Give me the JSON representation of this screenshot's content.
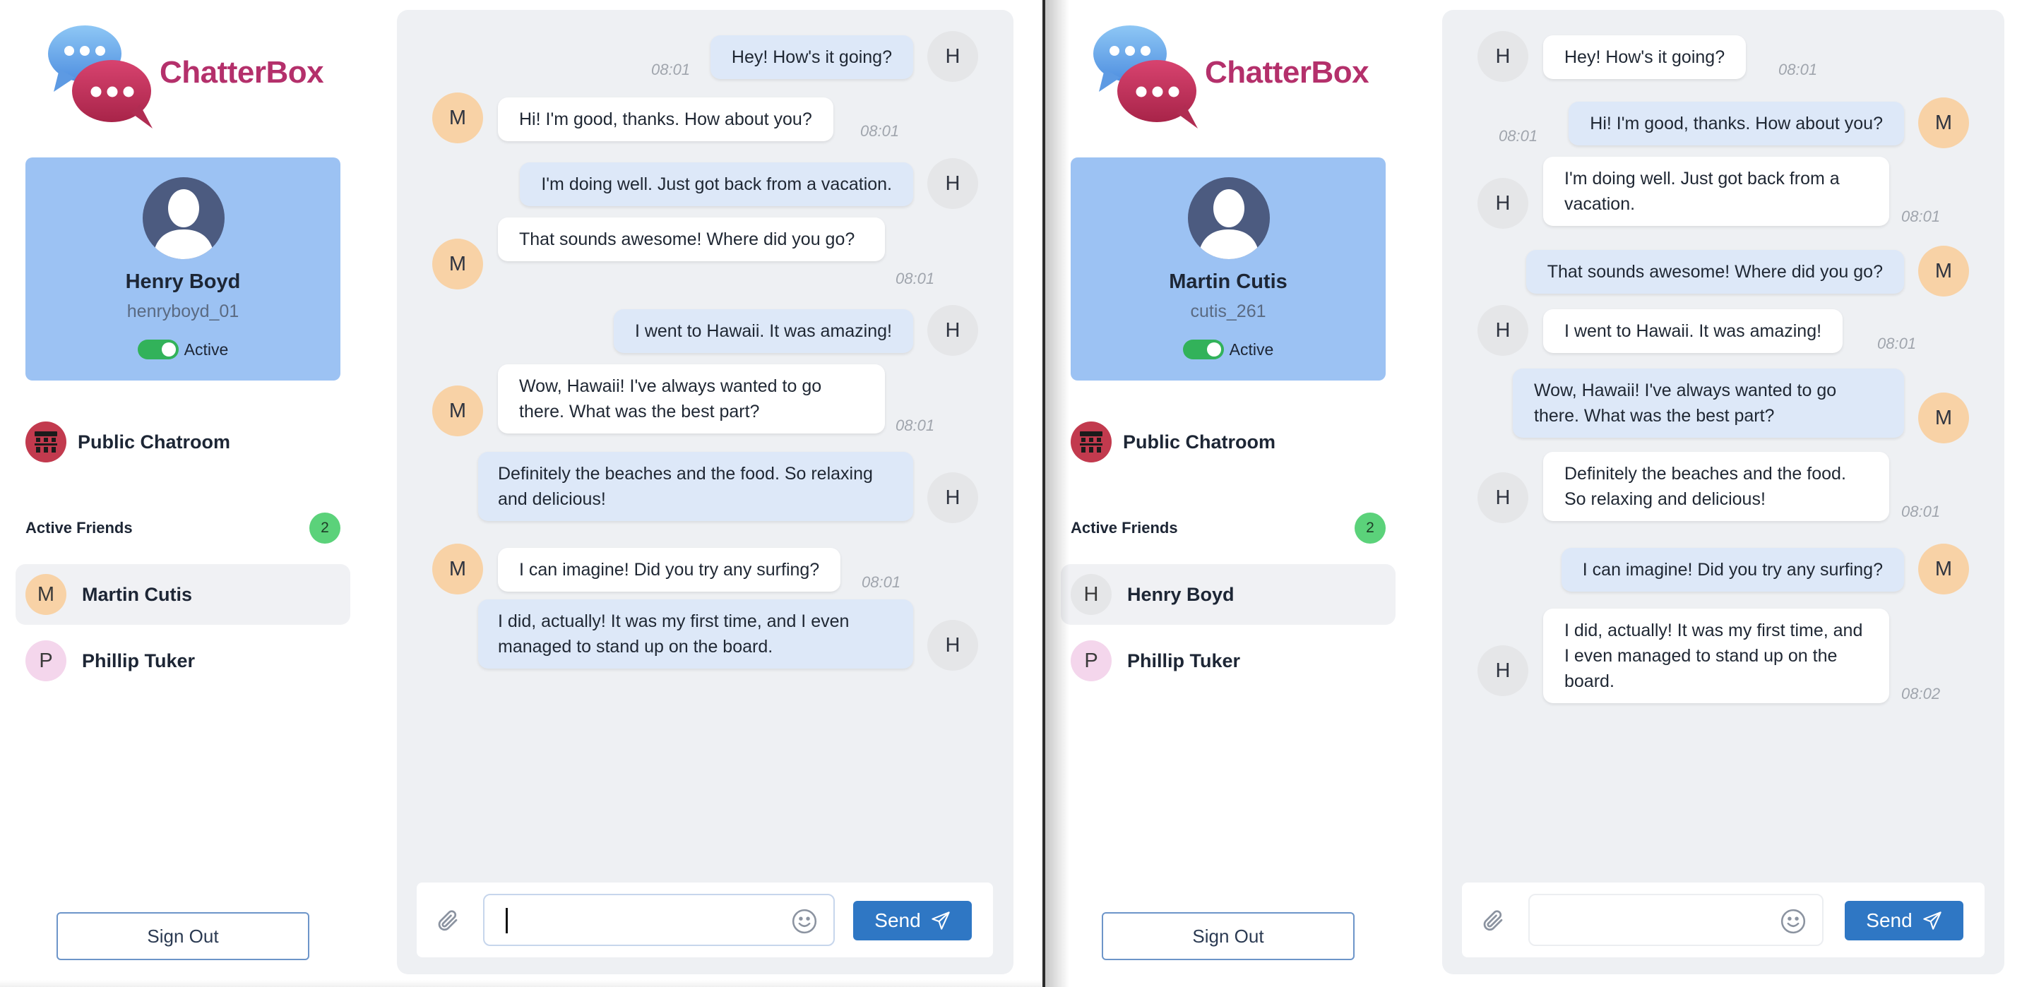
{
  "app": {
    "name": "ChatterBox"
  },
  "panels": [
    {
      "profile": {
        "name": "Henry Boyd",
        "username": "henryboyd_01",
        "status": "Active"
      },
      "public_chatroom": "Public Chatroom",
      "active_friends": {
        "title": "Active Friends",
        "count": "2",
        "items": [
          {
            "initial": "M",
            "name": "Martin Cutis"
          },
          {
            "initial": "P",
            "name": "Phillip Tuker"
          }
        ]
      },
      "sign_out": "Sign Out",
      "send_label": "Send",
      "input_value": "",
      "messages": [
        {
          "text": "Hey! How's it going?",
          "time": "08:01"
        },
        {
          "text": "Hi! I'm good, thanks. How about you?",
          "time": "08:01"
        },
        {
          "text": "I'm doing well. Just got back from a vacation."
        },
        {
          "text": "That sounds awesome! Where did you go?",
          "time": "08:01"
        },
        {
          "text": "I went to Hawaii. It was amazing!"
        },
        {
          "text": "Wow, Hawaii! I've always wanted to go there. What was the best part?",
          "time": "08:01"
        },
        {
          "text": "Definitely the beaches and the food. So relaxing and delicious!"
        },
        {
          "text": "I can imagine! Did you try any surfing?",
          "time": "08:01"
        },
        {
          "text": "I did, actually! It was my first time, and I even managed to stand up on the board."
        }
      ]
    },
    {
      "profile": {
        "name": "Martin Cutis",
        "username": "cutis_261",
        "status": "Active"
      },
      "public_chatroom": "Public Chatroom",
      "active_friends": {
        "title": "Active Friends",
        "count": "2",
        "items": [
          {
            "initial": "H",
            "name": "Henry Boyd"
          },
          {
            "initial": "P",
            "name": "Phillip Tuker"
          }
        ]
      },
      "sign_out": "Sign Out",
      "send_label": "Send",
      "input_value": "",
      "messages": [
        {
          "text": "Hey! How's it going?",
          "time": "08:01"
        },
        {
          "text": "Hi! I'm good, thanks. How about you?",
          "time": "08:01"
        },
        {
          "text": "I'm doing well. Just got back from a vacation.",
          "time": "08:01"
        },
        {
          "text": "That sounds awesome! Where did you go?"
        },
        {
          "text": "I went to Hawaii. It was amazing!",
          "time": "08:01"
        },
        {
          "text": "Wow, Hawaii! I've always wanted to go there. What was the best part?"
        },
        {
          "text": "Definitely the beaches and the food. So relaxing and delicious!",
          "time": "08:01"
        },
        {
          "text": "I can imagine! Did you try any surfing?"
        },
        {
          "text": "I did, actually! It was my first time, and I even managed to stand up on the board.",
          "time": "08:02"
        }
      ]
    }
  ],
  "colors": {
    "brand": "#b4306b",
    "profile_bg": "#9cc2f3",
    "send": "#2f77c4",
    "active": "#32b25a"
  },
  "icons": [
    "chat-bubbles-logo-icon",
    "user-avatar-icon",
    "public-chatroom-icon",
    "paperclip-icon",
    "emoji-icon",
    "send-icon"
  ]
}
